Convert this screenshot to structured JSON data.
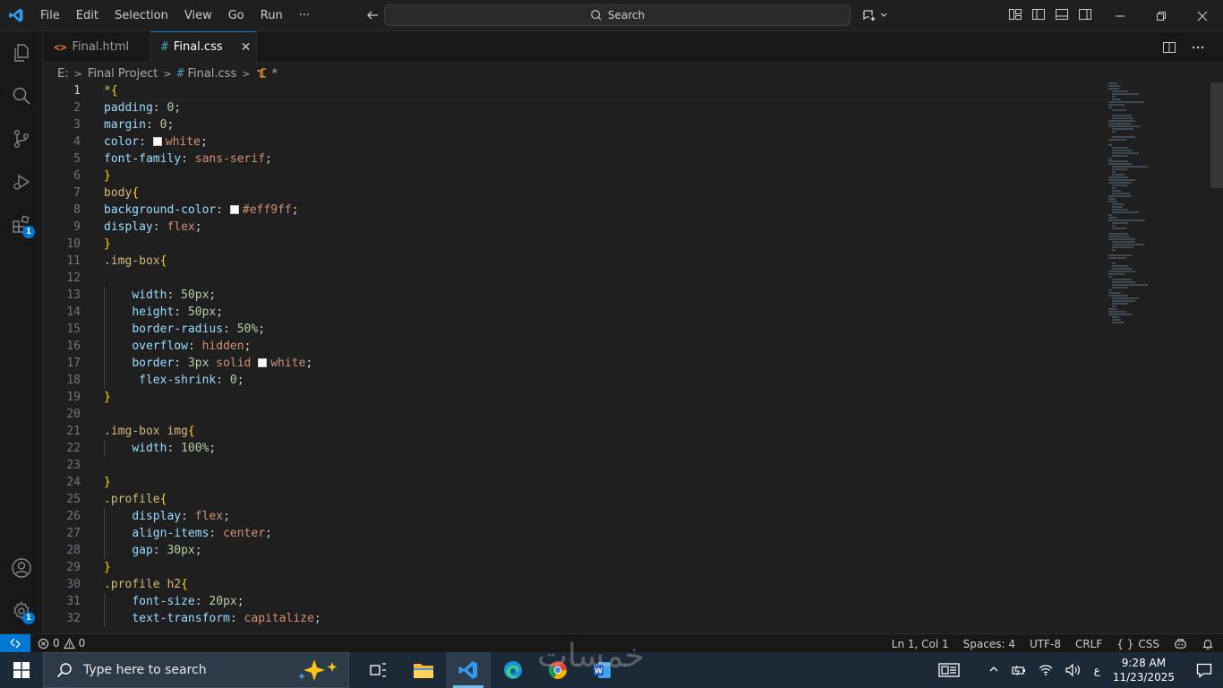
{
  "menu": [
    "File",
    "Edit",
    "Selection",
    "View",
    "Go",
    "Run",
    "···"
  ],
  "search": {
    "label": "Search"
  },
  "tabs": [
    {
      "label": "Final.html",
      "icon": "html-file-icon",
      "active": false
    },
    {
      "label": "Final.css",
      "icon": "css-file-icon",
      "active": true
    }
  ],
  "breadcrumb": {
    "drive": "E:",
    "folder": "Final Project",
    "file": "Final.css",
    "symbol": "*"
  },
  "activity": {
    "extensions_badge": "1",
    "settings_badge": "1"
  },
  "editor": {
    "current_line": 1,
    "lines": [
      "*{",
      "padding: 0;",
      "margin: 0;",
      "color: white;",
      "font-family: sans-serif;",
      "}",
      "body{",
      "background-color: #eff9ff;",
      "display: flex;",
      "}",
      ".img-box{",
      "",
      "    width: 50px;",
      "    height: 50px;",
      "    border-radius: 50%;",
      "    overflow: hidden;",
      "    border: 3px solid white;",
      "     flex-shrink: 0;",
      "}",
      "",
      ".img-box img{",
      "    width: 100%;",
      "",
      "}",
      ".profile{",
      "    display: flex;",
      "    align-items: center;",
      "    gap: 30px;",
      "}",
      ".profile h2{",
      "    font-size: 20px;",
      "    text-transform: capitalize;"
    ]
  },
  "status": {
    "errors": "0",
    "warnings": "0",
    "position": "Ln 1, Col 1",
    "spaces": "Spaces: 4",
    "encoding": "UTF-8",
    "eol": "CRLF",
    "language": "CSS"
  },
  "taskbar": {
    "search_placeholder": "Type here to search",
    "watermark": "خمسات",
    "lang": "ع",
    "time": "9:28 AM",
    "date": "11/23/2025"
  },
  "colors": {
    "accent": "#0078d4",
    "property": "#9cdcfe",
    "value": "#ce9178",
    "number": "#b5cea8",
    "selector": "#d7ba7d",
    "brace": "#ffd700"
  }
}
